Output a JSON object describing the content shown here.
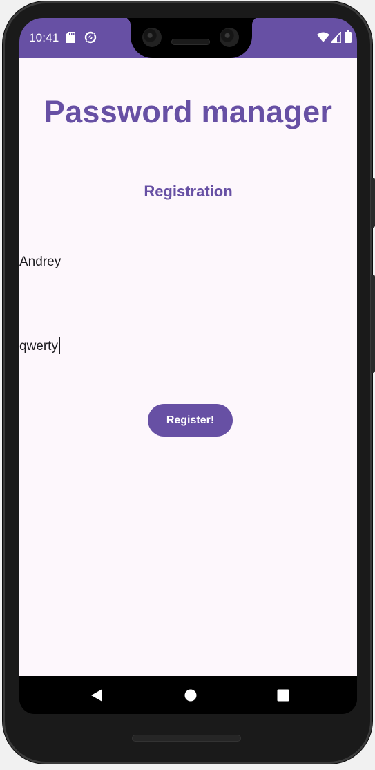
{
  "status_bar": {
    "time": "10:41",
    "icons": [
      "sd-card-icon",
      "sync-icon",
      "wifi-icon",
      "signal-icon",
      "battery-icon"
    ]
  },
  "app": {
    "title": "Password manager",
    "subtitle": "Registration",
    "login_value": "Andrey",
    "password_value": "qwerty",
    "register_label": "Register!"
  },
  "nav_bar": {
    "buttons": [
      "back-icon",
      "home-icon",
      "recents-icon"
    ]
  },
  "colors": {
    "primary": "#6750a4",
    "background": "#fdf7fc",
    "on_primary": "#ffffff",
    "text": "#1c1b1f"
  }
}
